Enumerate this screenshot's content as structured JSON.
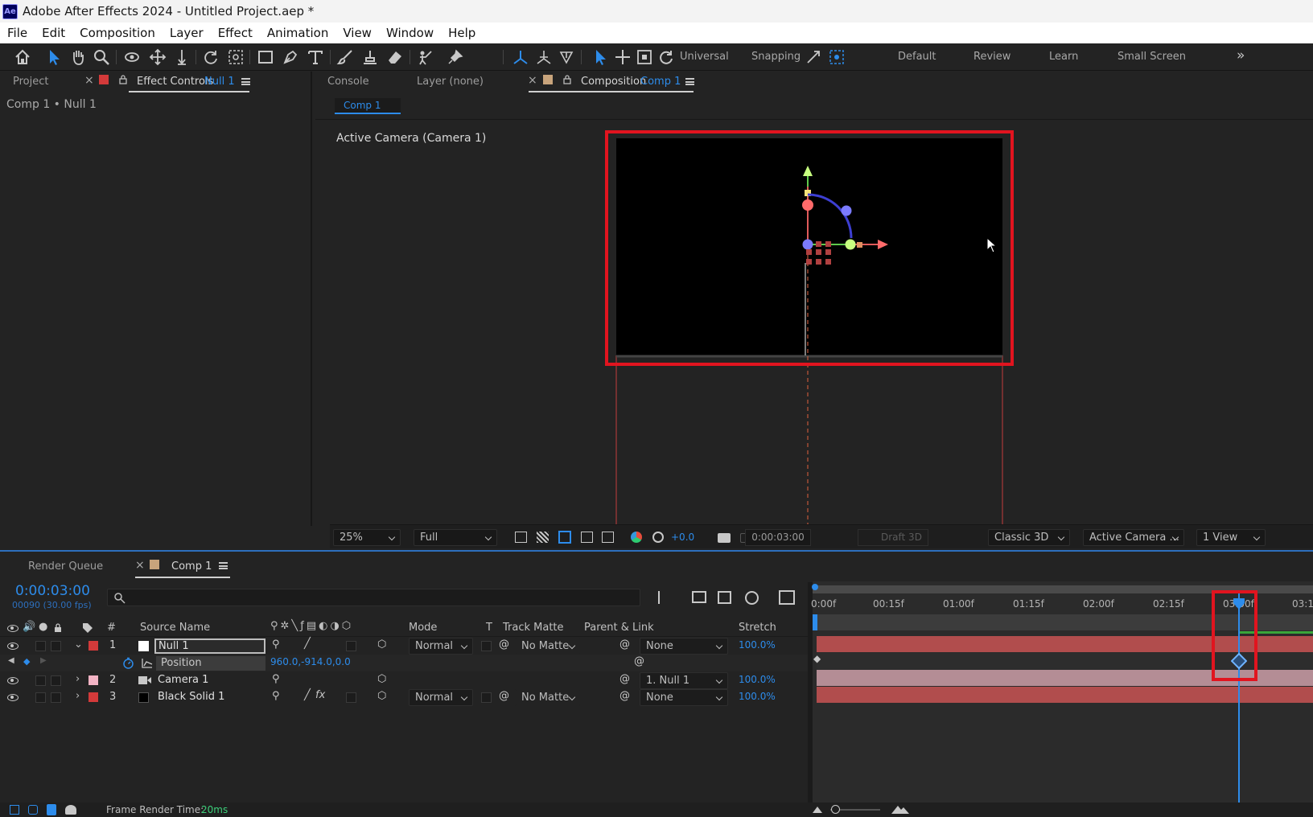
{
  "window": {
    "title": "Adobe After Effects 2024 - Untitled Project.aep *",
    "app_icon": "Ae"
  },
  "menu": [
    "File",
    "Edit",
    "Composition",
    "Layer",
    "Effect",
    "Animation",
    "View",
    "Window",
    "Help"
  ],
  "toolbar": {
    "axis_mode_label": "Universal",
    "snapping_label": "Snapping",
    "workspaces": [
      "Default",
      "Review",
      "Learn",
      "Small Screen"
    ],
    "more": "»"
  },
  "left_panel": {
    "tab_project": "Project",
    "tab_effect_controls": "Effect Controls",
    "tab_effect_controls_target": "Null 1",
    "breadcrumb": "Comp 1 • Null 1",
    "chip_color": "#d33a3a"
  },
  "comp_panel": {
    "tab_console": "Console",
    "tab_layer": "Layer (none)",
    "tab_composition": "Composition",
    "tab_composition_target": "Comp 1",
    "subtab": "Comp 1",
    "camera_label": "Active Camera (Camera 1)",
    "chip_color": "#c8a47c"
  },
  "viewer_footer": {
    "zoom": "25%",
    "resolution": "Full",
    "exposure": "+0.0",
    "timecode": "0:00:03:00",
    "draft3d": "Draft 3D",
    "renderer": "Classic 3D",
    "view": "Active Camera ...",
    "layout": "1 View"
  },
  "timeline": {
    "tab_render_queue": "Render Queue",
    "tab_comp": "Comp 1",
    "current_time": "0:00:03:00",
    "frame_info": "00090 (30.00 fps)",
    "headers": {
      "num": "#",
      "source_name": "Source Name",
      "mode": "Mode",
      "t": "T",
      "track_matte": "Track Matte",
      "parent_link": "Parent & Link",
      "stretch": "Stretch"
    },
    "ruler": [
      "0:00f",
      "00:15f",
      "01:00f",
      "01:15f",
      "02:00f",
      "02:15f",
      "03:00f",
      "03:1"
    ],
    "layers": [
      {
        "num": "1",
        "name": "Null 1",
        "label_color": "#d33a3a",
        "swatch": "#ffffff",
        "mode": "Normal",
        "matte": "No Matte",
        "parent": "None",
        "stretch": "100.0%"
      },
      {
        "num": "2",
        "name": "Camera 1",
        "label_color": "#f2b3c4",
        "swatch": "#f2b3c4",
        "mode": "",
        "matte": "",
        "parent": "1. Null 1",
        "stretch": "100.0%"
      },
      {
        "num": "3",
        "name": "Black Solid 1",
        "label_color": "#d33a3a",
        "swatch": "#000000",
        "mode": "Normal",
        "matte": "No Matte",
        "parent": "None",
        "stretch": "100.0%"
      }
    ],
    "property": {
      "name": "Position",
      "value": "960.0,-914.0,0.0"
    },
    "layer_bar_colors": {
      "null": "#b14d4d",
      "camera": "#b48d95",
      "solid": "#b14d4d"
    }
  },
  "status": {
    "frame_render_label": "Frame Render Time:",
    "frame_render_value": "20ms"
  }
}
